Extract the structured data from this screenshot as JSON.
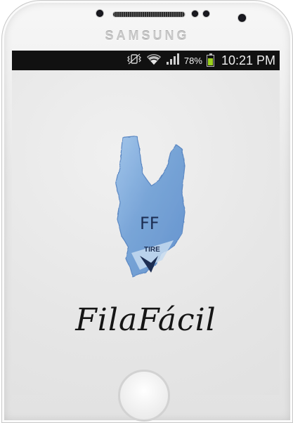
{
  "device": {
    "brand": "SAMSUNG"
  },
  "status_bar": {
    "battery_percent": "78%",
    "battery_level": 0.78,
    "time": "10:21 PM",
    "icons": [
      "vibrate-icon",
      "wifi-icon",
      "signal-icon",
      "battery-icon"
    ]
  },
  "splash": {
    "logo_text": "FF",
    "ticket_text": "TIRE",
    "app_name": "FilaFácil"
  },
  "colors": {
    "status_bar_bg": "#111111",
    "screen_bg": "#eaeaea",
    "logo_blue": "#7aa8d8",
    "battery_green": "#9cd21e",
    "app_name_color": "#151515"
  }
}
